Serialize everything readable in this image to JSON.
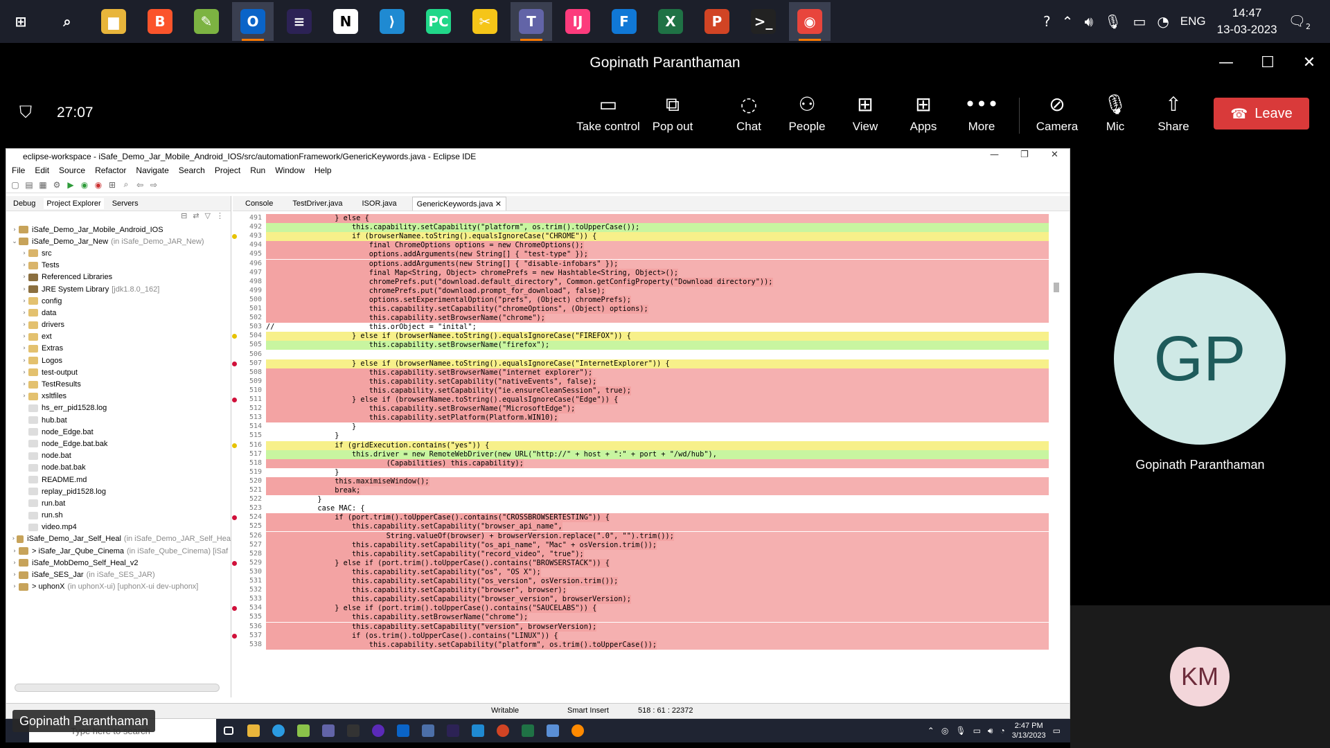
{
  "host_taskbar": {
    "apps": [
      {
        "name": "start",
        "label": "⊞",
        "color": "transparent"
      },
      {
        "name": "search",
        "label": "⌕",
        "color": "transparent"
      },
      {
        "name": "file-explorer",
        "label": "▆",
        "color": "#e8b53b"
      },
      {
        "name": "brave",
        "label": "B",
        "color": "#fb542b"
      },
      {
        "name": "notepad",
        "label": "✎",
        "color": "#7cb342"
      },
      {
        "name": "outlook",
        "label": "O",
        "color": "#0a64c8"
      },
      {
        "name": "eclipse",
        "label": "≡",
        "color": "#2c2255"
      },
      {
        "name": "notion",
        "label": "N",
        "color": "#ffffff"
      },
      {
        "name": "vscode",
        "label": "⟩",
        "color": "#1f8ad2"
      },
      {
        "name": "pycharm",
        "label": "PC",
        "color": "#21d789"
      },
      {
        "name": "snip",
        "label": "✂",
        "color": "#f5c518"
      },
      {
        "name": "teams",
        "label": "T",
        "color": "#6264a7"
      },
      {
        "name": "intellij",
        "label": "IJ",
        "color": "#fc3b7c"
      },
      {
        "name": "fiddler",
        "label": "F",
        "color": "#1078d6"
      },
      {
        "name": "excel",
        "label": "X",
        "color": "#1f7245"
      },
      {
        "name": "powerpoint",
        "label": "P",
        "color": "#d14424"
      },
      {
        "name": "terminal",
        "label": ">_",
        "color": "#222222"
      },
      {
        "name": "chrome",
        "label": "◉",
        "color": "#e8453c"
      }
    ],
    "lang": "ENG",
    "time": "14:47",
    "date": "13-03-2023",
    "notif_count": "2"
  },
  "teams": {
    "title": "Gopinath Paranthaman",
    "timer": "27:07",
    "buttons": {
      "take_control": "Take control",
      "pop_out": "Pop out",
      "chat": "Chat",
      "people": "People",
      "view": "View",
      "apps": "Apps",
      "more": "More",
      "camera": "Camera",
      "mic": "Mic",
      "share": "Share",
      "leave": "Leave"
    },
    "participant_main": {
      "initials": "GP",
      "name": "Gopinath Paranthaman"
    },
    "participant_small": {
      "initials": "KM"
    },
    "presenter_badge": "Gopinath Paranthaman"
  },
  "eclipse": {
    "title": "eclipse-workspace - iSafe_Demo_Jar_Mobile_Android_IOS/src/automationFramework/GenericKeywords.java - Eclipse IDE",
    "menu": [
      "File",
      "Edit",
      "Source",
      "Refactor",
      "Navigate",
      "Search",
      "Project",
      "Run",
      "Window",
      "Help"
    ],
    "left_tabs": [
      "Debug",
      "Project Explorer",
      "Servers"
    ],
    "tree": [
      {
        "text": "iSafe_Demo_Jar_Mobile_Android_IOS",
        "sub": "",
        "indent": 0,
        "arrow": "›",
        "icon": "#c7a35a"
      },
      {
        "text": "iSafe_Demo_Jar_New",
        "sub": "(in iSafe_Demo_JAR_New)",
        "indent": 0,
        "arrow": "⌄",
        "icon": "#c7a35a"
      },
      {
        "text": "src",
        "sub": "",
        "indent": 1,
        "arrow": "›",
        "icon": "#d9b46a"
      },
      {
        "text": "Tests",
        "sub": "",
        "indent": 1,
        "arrow": "›",
        "icon": "#d9b46a"
      },
      {
        "text": "Referenced Libraries",
        "sub": "",
        "indent": 1,
        "arrow": "›",
        "icon": "#8b6f3f"
      },
      {
        "text": "JRE System Library",
        "sub": "[jdk1.8.0_162]",
        "indent": 1,
        "arrow": "›",
        "icon": "#8b6f3f"
      },
      {
        "text": "config",
        "sub": "",
        "indent": 1,
        "arrow": "›",
        "icon": "#e3c16f"
      },
      {
        "text": "data",
        "sub": "",
        "indent": 1,
        "arrow": "›",
        "icon": "#e3c16f"
      },
      {
        "text": "drivers",
        "sub": "",
        "indent": 1,
        "arrow": "›",
        "icon": "#e3c16f"
      },
      {
        "text": "ext",
        "sub": "",
        "indent": 1,
        "arrow": "›",
        "icon": "#e3c16f"
      },
      {
        "text": "Extras",
        "sub": "",
        "indent": 1,
        "arrow": "›",
        "icon": "#e3c16f"
      },
      {
        "text": "Logos",
        "sub": "",
        "indent": 1,
        "arrow": "›",
        "icon": "#e3c16f"
      },
      {
        "text": "test-output",
        "sub": "",
        "indent": 1,
        "arrow": "›",
        "icon": "#e3c16f"
      },
      {
        "text": "TestResults",
        "sub": "",
        "indent": 1,
        "arrow": "›",
        "icon": "#e3c16f"
      },
      {
        "text": "xsltfiles",
        "sub": "",
        "indent": 1,
        "arrow": "›",
        "icon": "#e3c16f"
      },
      {
        "text": "hs_err_pid1528.log",
        "sub": "",
        "indent": 1,
        "arrow": "",
        "icon": "#dddddd"
      },
      {
        "text": "hub.bat",
        "sub": "",
        "indent": 1,
        "arrow": "",
        "icon": "#dddddd"
      },
      {
        "text": "node_Edge.bat",
        "sub": "",
        "indent": 1,
        "arrow": "",
        "icon": "#dddddd"
      },
      {
        "text": "node_Edge.bat.bak",
        "sub": "",
        "indent": 1,
        "arrow": "",
        "icon": "#dddddd"
      },
      {
        "text": "node.bat",
        "sub": "",
        "indent": 1,
        "arrow": "",
        "icon": "#dddddd"
      },
      {
        "text": "node.bat.bak",
        "sub": "",
        "indent": 1,
        "arrow": "",
        "icon": "#dddddd"
      },
      {
        "text": "README.md",
        "sub": "",
        "indent": 1,
        "arrow": "",
        "icon": "#dddddd"
      },
      {
        "text": "replay_pid1528.log",
        "sub": "",
        "indent": 1,
        "arrow": "",
        "icon": "#dddddd"
      },
      {
        "text": "run.bat",
        "sub": "",
        "indent": 1,
        "arrow": "",
        "icon": "#dddddd"
      },
      {
        "text": "run.sh",
        "sub": "",
        "indent": 1,
        "arrow": "",
        "icon": "#dddddd"
      },
      {
        "text": "video.mp4",
        "sub": "",
        "indent": 1,
        "arrow": "",
        "icon": "#dddddd"
      },
      {
        "text": "iSafe_Demo_Jar_Self_Heal",
        "sub": "(in iSafe_Demo_JAR_Self_Hea",
        "indent": 0,
        "arrow": "›",
        "icon": "#c7a35a"
      },
      {
        "text": "> iSafe_Jar_Qube_Cinema",
        "sub": "(in iSafe_Qube_Cinema) [iSaf",
        "indent": 0,
        "arrow": "›",
        "icon": "#c7a35a"
      },
      {
        "text": "iSafe_MobDemo_Self_Heal_v2",
        "sub": "",
        "indent": 0,
        "arrow": "›",
        "icon": "#c7a35a"
      },
      {
        "text": "iSafe_SES_Jar",
        "sub": "(in iSafe_SES_JAR)",
        "indent": 0,
        "arrow": "›",
        "icon": "#c7a35a"
      },
      {
        "text": "> uphonX",
        "sub": "(in uphonX-ui) [uphonX-ui dev-uphonx]",
        "indent": 0,
        "arrow": "›",
        "icon": "#c7a35a"
      }
    ],
    "editor_tabs": [
      "Console",
      "TestDriver.java",
      "ISOR.java",
      "GenericKeywords.java"
    ],
    "code": [
      {
        "n": "491",
        "t": "                } else {",
        "bg": "#f3a3a3",
        "m": ""
      },
      {
        "n": "492",
        "t": "                    this.capability.setCapability(\"platform\", os.trim().toUpperCase());",
        "bg": "#c8f5a0",
        "m": ""
      },
      {
        "n": "493",
        "t": "                    if (browserNamee.toString().equalsIgnoreCase(\"CHROME\")) {",
        "bg": "#f7f08a",
        "m": "#e6c200"
      },
      {
        "n": "494",
        "t": "                        final ChromeOptions options = new ChromeOptions();",
        "bg": "#f3a3a3",
        "m": ""
      },
      {
        "n": "495",
        "t": "                        options.addArguments(new String[] { \"test-type\" });",
        "bg": "#f3a3a3",
        "m": ""
      },
      {
        "n": "496",
        "t": "                        options.addArguments(new String[] { \"disable-infobars\" });",
        "bg": "#f3a3a3",
        "m": ""
      },
      {
        "n": "497",
        "t": "                        final Map<String, Object> chromePrefs = new Hashtable<String, Object>();",
        "bg": "#f3a3a3",
        "m": ""
      },
      {
        "n": "498",
        "t": "                        chromePrefs.put(\"download.default_directory\", Common.getConfigProperty(\"Download directory\"));",
        "bg": "#f3a3a3",
        "m": ""
      },
      {
        "n": "499",
        "t": "                        chromePrefs.put(\"download.prompt_for_download\", false);",
        "bg": "#f3a3a3",
        "m": ""
      },
      {
        "n": "500",
        "t": "                        options.setExperimentalOption(\"prefs\", (Object) chromePrefs);",
        "bg": "#f3a3a3",
        "m": ""
      },
      {
        "n": "501",
        "t": "                        this.capability.setCapability(\"chromeOptions\", (Object) options);",
        "bg": "#f3a3a3",
        "m": ""
      },
      {
        "n": "502",
        "t": "                        this.capability.setBrowserName(\"chrome\");",
        "bg": "#f3a3a3",
        "m": ""
      },
      {
        "n": "503",
        "t": "//                      this.orObject = \"inital\";",
        "bg": "",
        "m": ""
      },
      {
        "n": "504",
        "t": "                    } else if (browserNamee.toString().equalsIgnoreCase(\"FIREFOX\")) {",
        "bg": "#f7f08a",
        "m": "#e6c200"
      },
      {
        "n": "505",
        "t": "                        this.capability.setBrowserName(\"firefox\");",
        "bg": "#c8f5a0",
        "m": ""
      },
      {
        "n": "506",
        "t": "",
        "bg": "",
        "m": ""
      },
      {
        "n": "507",
        "t": "                    } else if (browserNamee.toString().equalsIgnoreCase(\"InternetExplorer\")) {",
        "bg": "#f7f08a",
        "m": "#d0103a"
      },
      {
        "n": "508",
        "t": "                        this.capability.setBrowserName(\"internet explorer\");",
        "bg": "#f3a3a3",
        "m": ""
      },
      {
        "n": "509",
        "t": "                        this.capability.setCapability(\"nativeEvents\", false);",
        "bg": "#f3a3a3",
        "m": ""
      },
      {
        "n": "510",
        "t": "                        this.capability.setCapability(\"ie.ensureCleanSession\", true);",
        "bg": "#f3a3a3",
        "m": ""
      },
      {
        "n": "511",
        "t": "                    } else if (browserNamee.toString().equalsIgnoreCase(\"Edge\")) {",
        "bg": "#f3a3a3",
        "m": "#d0103a"
      },
      {
        "n": "512",
        "t": "                        this.capability.setBrowserName(\"MicrosoftEdge\");",
        "bg": "#f3a3a3",
        "m": ""
      },
      {
        "n": "513",
        "t": "                        this.capability.setPlatform(Platform.WIN10);",
        "bg": "#f3a3a3",
        "m": ""
      },
      {
        "n": "514",
        "t": "                    }",
        "bg": "",
        "m": ""
      },
      {
        "n": "515",
        "t": "                }",
        "bg": "",
        "m": ""
      },
      {
        "n": "516",
        "t": "                if (gridExecution.contains(\"yes\")) {",
        "bg": "#f7f08a",
        "m": "#e6c200"
      },
      {
        "n": "517",
        "t": "                    this.driver = new RemoteWebDriver(new URL(\"http://\" + host + \":\" + port + \"/wd/hub\"),",
        "bg": "#c8f5a0",
        "m": ""
      },
      {
        "n": "518",
        "t": "                            (Capabilities) this.capability);",
        "bg": "#f3a3a3",
        "m": ""
      },
      {
        "n": "519",
        "t": "                }",
        "bg": "",
        "m": ""
      },
      {
        "n": "520",
        "t": "                this.maximiseWindow();",
        "bg": "#f3a3a3",
        "m": ""
      },
      {
        "n": "521",
        "t": "                break;",
        "bg": "#f3a3a3",
        "m": ""
      },
      {
        "n": "522",
        "t": "            }",
        "bg": "",
        "m": ""
      },
      {
        "n": "523",
        "t": "            case MAC: {",
        "bg": "",
        "m": ""
      },
      {
        "n": "524",
        "t": "                if (port.trim().toUpperCase().contains(\"CROSSBROWSERTESTING\")) {",
        "bg": "#f3a3a3",
        "m": "#d0103a"
      },
      {
        "n": "525",
        "t": "                    this.capability.setCapability(\"browser_api_name\",",
        "bg": "#f3a3a3",
        "m": ""
      },
      {
        "n": "526",
        "t": "                            String.valueOf(browser) + browserVersion.replace(\".0\", \"\").trim());",
        "bg": "#f3a3a3",
        "m": ""
      },
      {
        "n": "527",
        "t": "                    this.capability.setCapability(\"os_api_name\", \"Mac\" + osVersion.trim());",
        "bg": "#f3a3a3",
        "m": ""
      },
      {
        "n": "528",
        "t": "                    this.capability.setCapability(\"record_video\", \"true\");",
        "bg": "#f3a3a3",
        "m": ""
      },
      {
        "n": "529",
        "t": "                } else if (port.trim().toUpperCase().contains(\"BROWSERSTACK\")) {",
        "bg": "#f3a3a3",
        "m": "#d0103a"
      },
      {
        "n": "530",
        "t": "                    this.capability.setCapability(\"os\", \"OS X\");",
        "bg": "#f3a3a3",
        "m": ""
      },
      {
        "n": "531",
        "t": "                    this.capability.setCapability(\"os_version\", osVersion.trim());",
        "bg": "#f3a3a3",
        "m": ""
      },
      {
        "n": "532",
        "t": "                    this.capability.setCapability(\"browser\", browser);",
        "bg": "#f3a3a3",
        "m": ""
      },
      {
        "n": "533",
        "t": "                    this.capability.setCapability(\"browser_version\", browserVersion);",
        "bg": "#f3a3a3",
        "m": ""
      },
      {
        "n": "534",
        "t": "                } else if (port.trim().toUpperCase().contains(\"SAUCELABS\")) {",
        "bg": "#f3a3a3",
        "m": "#d0103a"
      },
      {
        "n": "535",
        "t": "                    this.capability.setBrowserName(\"chrome\");",
        "bg": "#f3a3a3",
        "m": ""
      },
      {
        "n": "536",
        "t": "                    this.capability.setCapability(\"version\", browserVersion);",
        "bg": "#f3a3a3",
        "m": ""
      },
      {
        "n": "537",
        "t": "                    if (os.trim().toUpperCase().contains(\"LINUX\")) {",
        "bg": "#f3a3a3",
        "m": "#d0103a"
      },
      {
        "n": "538",
        "t": "                        this.capability.setCapability(\"platform\", os.trim().toUpperCase());",
        "bg": "#f3a3a3",
        "m": ""
      }
    ],
    "status": {
      "mode": "Writable",
      "insert": "Smart Insert",
      "position": "518 : 61 : 22372"
    }
  },
  "guest_taskbar": {
    "search_placeholder": "Type here to search",
    "time": "2:47 PM",
    "date": "3/13/2023"
  }
}
